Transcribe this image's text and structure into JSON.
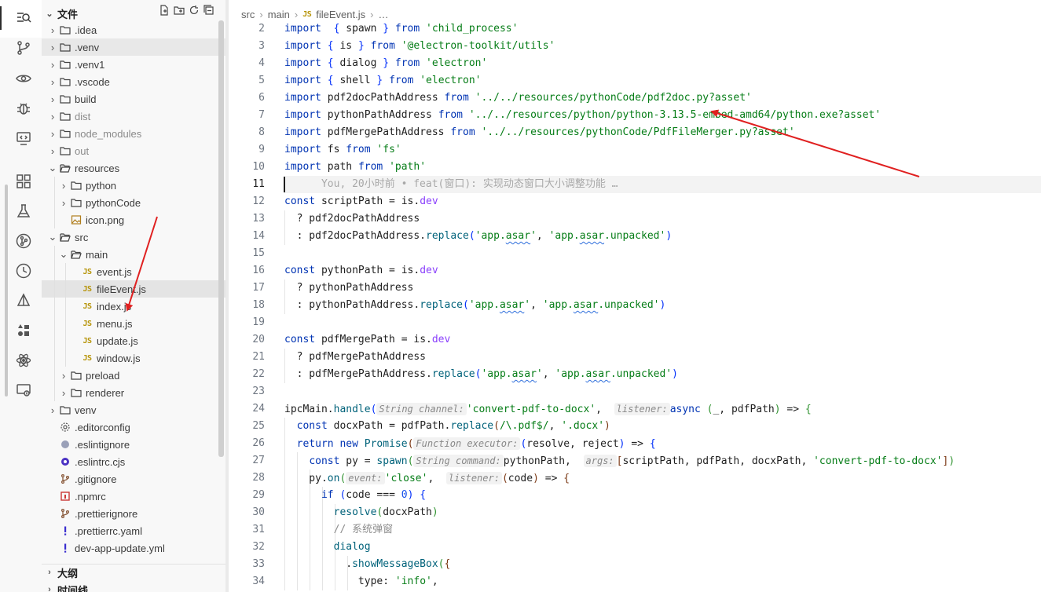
{
  "activity_bar": {
    "icons": [
      "search-icon",
      "source-control-icon",
      "eye-icon",
      "debug-icon",
      "remote-icon",
      "extensions-icon",
      "test-flask-icon",
      "git-graph-icon",
      "history-icon",
      "docker-icon",
      "components-icon",
      "react-atom-icon",
      "cast-icon"
    ]
  },
  "sidebar": {
    "title": "文件",
    "outline_label": "大纲",
    "timeline_label": "时间线",
    "tree": [
      {
        "label": ".idea",
        "kind": "folder",
        "depth": 0,
        "open": false
      },
      {
        "label": ".venv",
        "kind": "folder",
        "depth": 0,
        "open": false
      },
      {
        "label": ".venv1",
        "kind": "folder",
        "depth": 0,
        "open": false
      },
      {
        "label": ".vscode",
        "kind": "folder",
        "depth": 0,
        "open": false
      },
      {
        "label": "build",
        "kind": "folder",
        "depth": 0,
        "open": false
      },
      {
        "label": "dist",
        "kind": "folder",
        "depth": 0,
        "open": false,
        "dim": true
      },
      {
        "label": "node_modules",
        "kind": "folder",
        "depth": 0,
        "open": false,
        "dim": true
      },
      {
        "label": "out",
        "kind": "folder",
        "depth": 0,
        "open": false,
        "dim": true
      },
      {
        "label": "resources",
        "kind": "folder",
        "depth": 0,
        "open": true
      },
      {
        "label": "python",
        "kind": "folder",
        "depth": 1,
        "open": false
      },
      {
        "label": "pythonCode",
        "kind": "folder",
        "depth": 1,
        "open": false
      },
      {
        "label": "icon.png",
        "kind": "image",
        "depth": 1
      },
      {
        "label": "src",
        "kind": "folder",
        "depth": 0,
        "open": true
      },
      {
        "label": "main",
        "kind": "folder",
        "depth": 1,
        "open": true
      },
      {
        "label": "event.js",
        "kind": "js",
        "depth": 2
      },
      {
        "label": "fileEvent.js",
        "kind": "js",
        "depth": 2,
        "selected": true
      },
      {
        "label": "index.js",
        "kind": "js",
        "depth": 2
      },
      {
        "label": "menu.js",
        "kind": "js",
        "depth": 2
      },
      {
        "label": "update.js",
        "kind": "js",
        "depth": 2
      },
      {
        "label": "window.js",
        "kind": "js",
        "depth": 2
      },
      {
        "label": "preload",
        "kind": "folder",
        "depth": 1,
        "open": false
      },
      {
        "label": "renderer",
        "kind": "folder",
        "depth": 1,
        "open": false
      },
      {
        "label": "venv",
        "kind": "folder",
        "depth": 0,
        "open": false
      },
      {
        "label": ".editorconfig",
        "kind": "gear",
        "depth": 0
      },
      {
        "label": ".eslintignore",
        "kind": "eslint",
        "depth": 0
      },
      {
        "label": ".eslintrc.cjs",
        "kind": "eslint2",
        "depth": 0
      },
      {
        "label": ".gitignore",
        "kind": "git",
        "depth": 0
      },
      {
        "label": ".npmrc",
        "kind": "npm",
        "depth": 0
      },
      {
        "label": ".prettierignore",
        "kind": "git",
        "depth": 0
      },
      {
        "label": ".prettierrc.yaml",
        "kind": "yaml",
        "depth": 0
      },
      {
        "label": "dev-app-update.yml",
        "kind": "yaml",
        "depth": 0
      }
    ]
  },
  "breadcrumb": [
    "src",
    "main",
    "fileEvent.js",
    "…"
  ],
  "editor": {
    "line_numbers": [
      2,
      3,
      4,
      5,
      6,
      7,
      8,
      9,
      10,
      11,
      12,
      13,
      14,
      15,
      16,
      17,
      18,
      19,
      20,
      21,
      22,
      23,
      24,
      25,
      26,
      27,
      28,
      29,
      30,
      31,
      32,
      33,
      34
    ],
    "current_line": 11,
    "lines": [
      [
        [
          "k",
          "import"
        ],
        [
          "",
          "  "
        ],
        [
          "b1",
          "{"
        ],
        [
          "",
          " spawn "
        ],
        [
          "b1",
          "}"
        ],
        [
          "",
          " "
        ],
        [
          "k",
          "from"
        ],
        [
          "",
          " "
        ],
        [
          "s",
          "'child_process'"
        ]
      ],
      [
        [
          "k",
          "import"
        ],
        [
          "",
          " "
        ],
        [
          "b1",
          "{"
        ],
        [
          "",
          " is "
        ],
        [
          "b1",
          "}"
        ],
        [
          "",
          " "
        ],
        [
          "k",
          "from"
        ],
        [
          "",
          " "
        ],
        [
          "s",
          "'@electron-toolkit/utils'"
        ]
      ],
      [
        [
          "k",
          "import"
        ],
        [
          "",
          " "
        ],
        [
          "b1",
          "{"
        ],
        [
          "",
          " dialog "
        ],
        [
          "b1",
          "}"
        ],
        [
          "",
          " "
        ],
        [
          "k",
          "from"
        ],
        [
          "",
          " "
        ],
        [
          "s",
          "'electron'"
        ]
      ],
      [
        [
          "k",
          "import"
        ],
        [
          "",
          " "
        ],
        [
          "b1",
          "{"
        ],
        [
          "",
          " shell "
        ],
        [
          "b1",
          "}"
        ],
        [
          "",
          " "
        ],
        [
          "k",
          "from"
        ],
        [
          "",
          " "
        ],
        [
          "s",
          "'electron'"
        ]
      ],
      [
        [
          "k",
          "import"
        ],
        [
          "",
          " pdf2docPathAddress "
        ],
        [
          "k",
          "from"
        ],
        [
          "",
          " "
        ],
        [
          "s",
          "'../../resources/pythonCode/pdf2doc.py?asset'"
        ]
      ],
      [
        [
          "k",
          "import"
        ],
        [
          "",
          " pythonPathAddress "
        ],
        [
          "k",
          "from"
        ],
        [
          "",
          " "
        ],
        [
          "s",
          "'../../resources/python/python-3.13.5-embed-amd64/python.exe?asset'"
        ]
      ],
      [
        [
          "k",
          "import"
        ],
        [
          "",
          " pdfMergePathAddress "
        ],
        [
          "k",
          "from"
        ],
        [
          "",
          " "
        ],
        [
          "s",
          "'../../resources/pythonCode/PdfFileMerger.py?asset'"
        ]
      ],
      [
        [
          "k",
          "import"
        ],
        [
          "",
          " fs "
        ],
        [
          "k",
          "from"
        ],
        [
          "",
          " "
        ],
        [
          "s",
          "'fs'"
        ]
      ],
      [
        [
          "k",
          "import"
        ],
        [
          "",
          " path "
        ],
        [
          "k",
          "from"
        ],
        [
          "",
          " "
        ],
        [
          "s",
          "'path'"
        ]
      ],
      [
        [
          "ghost",
          "      You, 20小时前 • feat(窗口): 实现动态窗口大小调整功能 …"
        ]
      ],
      [
        [
          "k",
          "const"
        ],
        [
          "",
          " scriptPath = is."
        ],
        [
          "f",
          "dev"
        ]
      ],
      [
        [
          "",
          "  ? pdf2docPathAddress"
        ]
      ],
      [
        [
          "",
          "  : pdf2docPathAddress."
        ],
        [
          "fn",
          "replace"
        ],
        [
          "b1",
          "("
        ],
        [
          "s",
          "'app."
        ],
        [
          "sq",
          "asar"
        ],
        [
          "s",
          "'"
        ],
        [
          "",
          ", "
        ],
        [
          "s",
          "'app."
        ],
        [
          "sq",
          "asar"
        ],
        [
          "s",
          ".unpacked'"
        ],
        [
          "b1",
          ")"
        ]
      ],
      [
        [
          "",
          ""
        ]
      ],
      [
        [
          "k",
          "const"
        ],
        [
          "",
          " pythonPath = is."
        ],
        [
          "f",
          "dev"
        ]
      ],
      [
        [
          "",
          "  ? pythonPathAddress"
        ]
      ],
      [
        [
          "",
          "  : pythonPathAddress."
        ],
        [
          "fn",
          "replace"
        ],
        [
          "b1",
          "("
        ],
        [
          "s",
          "'app."
        ],
        [
          "sq",
          "asar"
        ],
        [
          "s",
          "'"
        ],
        [
          "",
          ", "
        ],
        [
          "s",
          "'app."
        ],
        [
          "sq",
          "asar"
        ],
        [
          "s",
          ".unpacked'"
        ],
        [
          "b1",
          ")"
        ]
      ],
      [
        [
          "",
          ""
        ]
      ],
      [
        [
          "k",
          "const"
        ],
        [
          "",
          " pdfMergePath = is."
        ],
        [
          "f",
          "dev"
        ]
      ],
      [
        [
          "",
          "  ? pdfMergePathAddress"
        ]
      ],
      [
        [
          "",
          "  : pdfMergePathAddress."
        ],
        [
          "fn",
          "replace"
        ],
        [
          "b1",
          "("
        ],
        [
          "s",
          "'app."
        ],
        [
          "sq",
          "asar"
        ],
        [
          "s",
          "'"
        ],
        [
          "",
          ", "
        ],
        [
          "s",
          "'app."
        ],
        [
          "sq",
          "asar"
        ],
        [
          "s",
          ".unpacked'"
        ],
        [
          "b1",
          ")"
        ]
      ],
      [
        [
          "",
          ""
        ]
      ],
      [
        [
          "",
          "ipcMain."
        ],
        [
          "fn",
          "handle"
        ],
        [
          "b1",
          "("
        ],
        [
          "hint",
          "String channel:"
        ],
        [
          "s",
          "'convert-pdf-to-docx'"
        ],
        [
          "",
          ",  "
        ],
        [
          "hint",
          "listener:"
        ],
        [
          "k",
          "async"
        ],
        [
          "",
          " "
        ],
        [
          "b2",
          "("
        ],
        [
          "",
          "_, pdfPath"
        ],
        [
          "b2",
          ")"
        ],
        [
          "",
          " => "
        ],
        [
          "b2",
          "{"
        ]
      ],
      [
        [
          "",
          "  "
        ],
        [
          "k",
          "const"
        ],
        [
          "",
          " docxPath = pdfPath."
        ],
        [
          "fn",
          "replace"
        ],
        [
          "b3",
          "("
        ],
        [
          "s",
          "/\\.pdf$/"
        ],
        [
          "",
          ", "
        ],
        [
          "s",
          "'.docx'"
        ],
        [
          "b3",
          ")"
        ]
      ],
      [
        [
          "",
          "  "
        ],
        [
          "k",
          "return"
        ],
        [
          "",
          " "
        ],
        [
          "k",
          "new"
        ],
        [
          "",
          " "
        ],
        [
          "fn",
          "Promise"
        ],
        [
          "b3",
          "("
        ],
        [
          "hint",
          "Function executor:"
        ],
        [
          "b1",
          "("
        ],
        [
          "",
          "resolve, reject"
        ],
        [
          "b1",
          ")"
        ],
        [
          "",
          " => "
        ],
        [
          "b1",
          "{"
        ]
      ],
      [
        [
          "",
          "    "
        ],
        [
          "k",
          "const"
        ],
        [
          "",
          " py = "
        ],
        [
          "fn",
          "spawn"
        ],
        [
          "b2",
          "("
        ],
        [
          "hint",
          "String command:"
        ],
        [
          "",
          "pythonPath,  "
        ],
        [
          "hint",
          "args:"
        ],
        [
          "b3",
          "["
        ],
        [
          "",
          "scriptPath, pdfPath, docxPath, "
        ],
        [
          "s",
          "'convert-pdf-to-docx'"
        ],
        [
          "b3",
          "]"
        ],
        [
          "b2",
          ")"
        ]
      ],
      [
        [
          "",
          "    py."
        ],
        [
          "fn",
          "on"
        ],
        [
          "b2",
          "("
        ],
        [
          "hint",
          "event:"
        ],
        [
          "s",
          "'close'"
        ],
        [
          "",
          ",  "
        ],
        [
          "hint",
          "listener:"
        ],
        [
          "b3",
          "("
        ],
        [
          "",
          "code"
        ],
        [
          "b3",
          ")"
        ],
        [
          "",
          " => "
        ],
        [
          "b3",
          "{"
        ]
      ],
      [
        [
          "",
          "      "
        ],
        [
          "k",
          "if"
        ],
        [
          "",
          " "
        ],
        [
          "b1",
          "("
        ],
        [
          "",
          "code === "
        ],
        [
          "n",
          "0"
        ],
        [
          "b1",
          ")"
        ],
        [
          "",
          " "
        ],
        [
          "b1",
          "{"
        ]
      ],
      [
        [
          "",
          "        "
        ],
        [
          "fn",
          "resolve"
        ],
        [
          "b2",
          "("
        ],
        [
          "",
          "docxPath"
        ],
        [
          "b2",
          ")"
        ]
      ],
      [
        [
          "",
          "        "
        ],
        [
          "cm",
          "// 系统弹窗"
        ]
      ],
      [
        [
          "",
          "        "
        ],
        [
          "fn",
          "dialog"
        ]
      ],
      [
        [
          "",
          "          ."
        ],
        [
          "fn",
          "showMessageBox"
        ],
        [
          "b2",
          "("
        ],
        [
          "b3",
          "{"
        ]
      ],
      [
        [
          "",
          "            type: "
        ],
        [
          "s",
          "'info'"
        ],
        [
          "",
          ","
        ]
      ]
    ]
  }
}
